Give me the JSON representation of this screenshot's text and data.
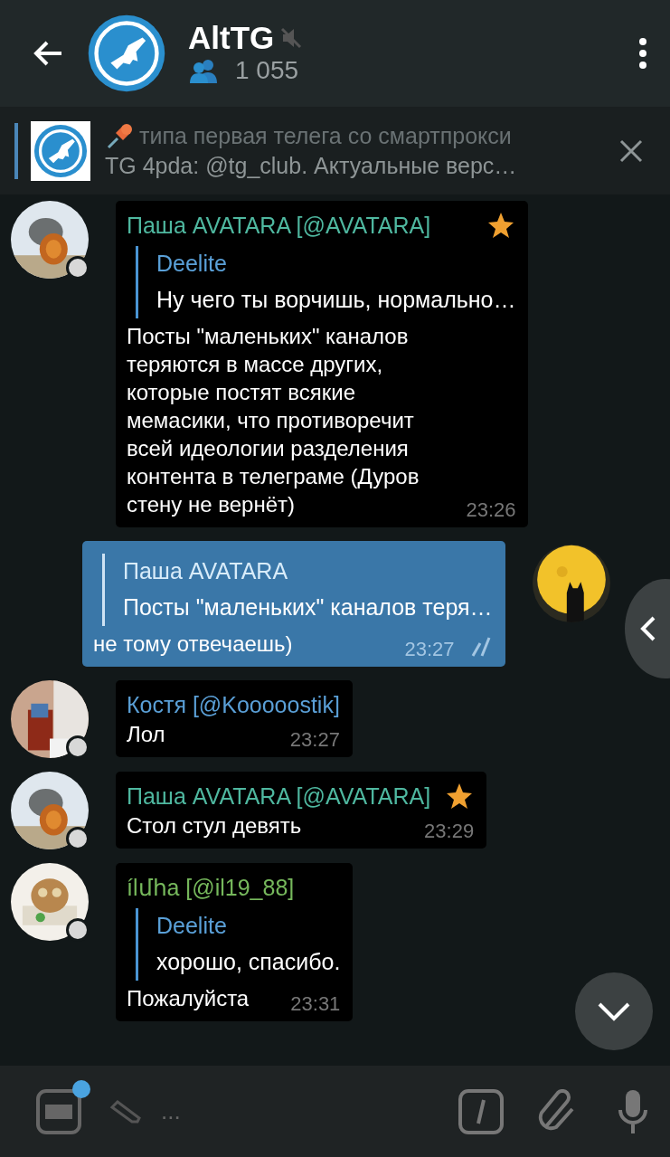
{
  "header": {
    "title": "AltTG",
    "muted": true,
    "members": "1 055"
  },
  "pinned": {
    "title": "типа первая телега со смартпрокси",
    "text": "TG 4pda: @tg_club. Актуальные верс…"
  },
  "messages": [
    {
      "kind": "incoming",
      "sender": "Паша AVATARA [@AVATARA]",
      "color": "#4fb8a0",
      "admin": true,
      "reply": {
        "name": "Deelite",
        "text": "Ну чего ты ворчишь, нормально…"
      },
      "text": "Посты \"маленьких\" каналов теряются в массе других, которые постят всякие мемасики, что противоречит всей идеологии разделения контента в телеграме (Дуров стену не вернёт)",
      "time": "23:26"
    },
    {
      "kind": "outgoing",
      "reply": {
        "name": "Паша AVATARA",
        "text": "Посты \"маленьких\" каналов теря…"
      },
      "text": "не тому отвечаешь)",
      "time": "23:27",
      "read": true
    },
    {
      "kind": "incoming",
      "sender": "Костя [@Kooooostik]",
      "color": "#5a9fd6",
      "admin": false,
      "text": "Лол",
      "time": "23:27"
    },
    {
      "kind": "incoming",
      "sender": "Паша AVATARA [@AVATARA]",
      "color": "#4fb8a0",
      "admin": true,
      "text": "Стол стул девять",
      "time": "23:29"
    },
    {
      "kind": "incoming",
      "sender": "ílմհa [@il19_88]",
      "color": "#76b85c",
      "admin": false,
      "reply": {
        "name": "Deelite",
        "text": "хорошо, спасибо."
      },
      "text": "Пожалуйста",
      "time": "23:31"
    }
  ],
  "composer": {
    "placeholder": "..."
  }
}
